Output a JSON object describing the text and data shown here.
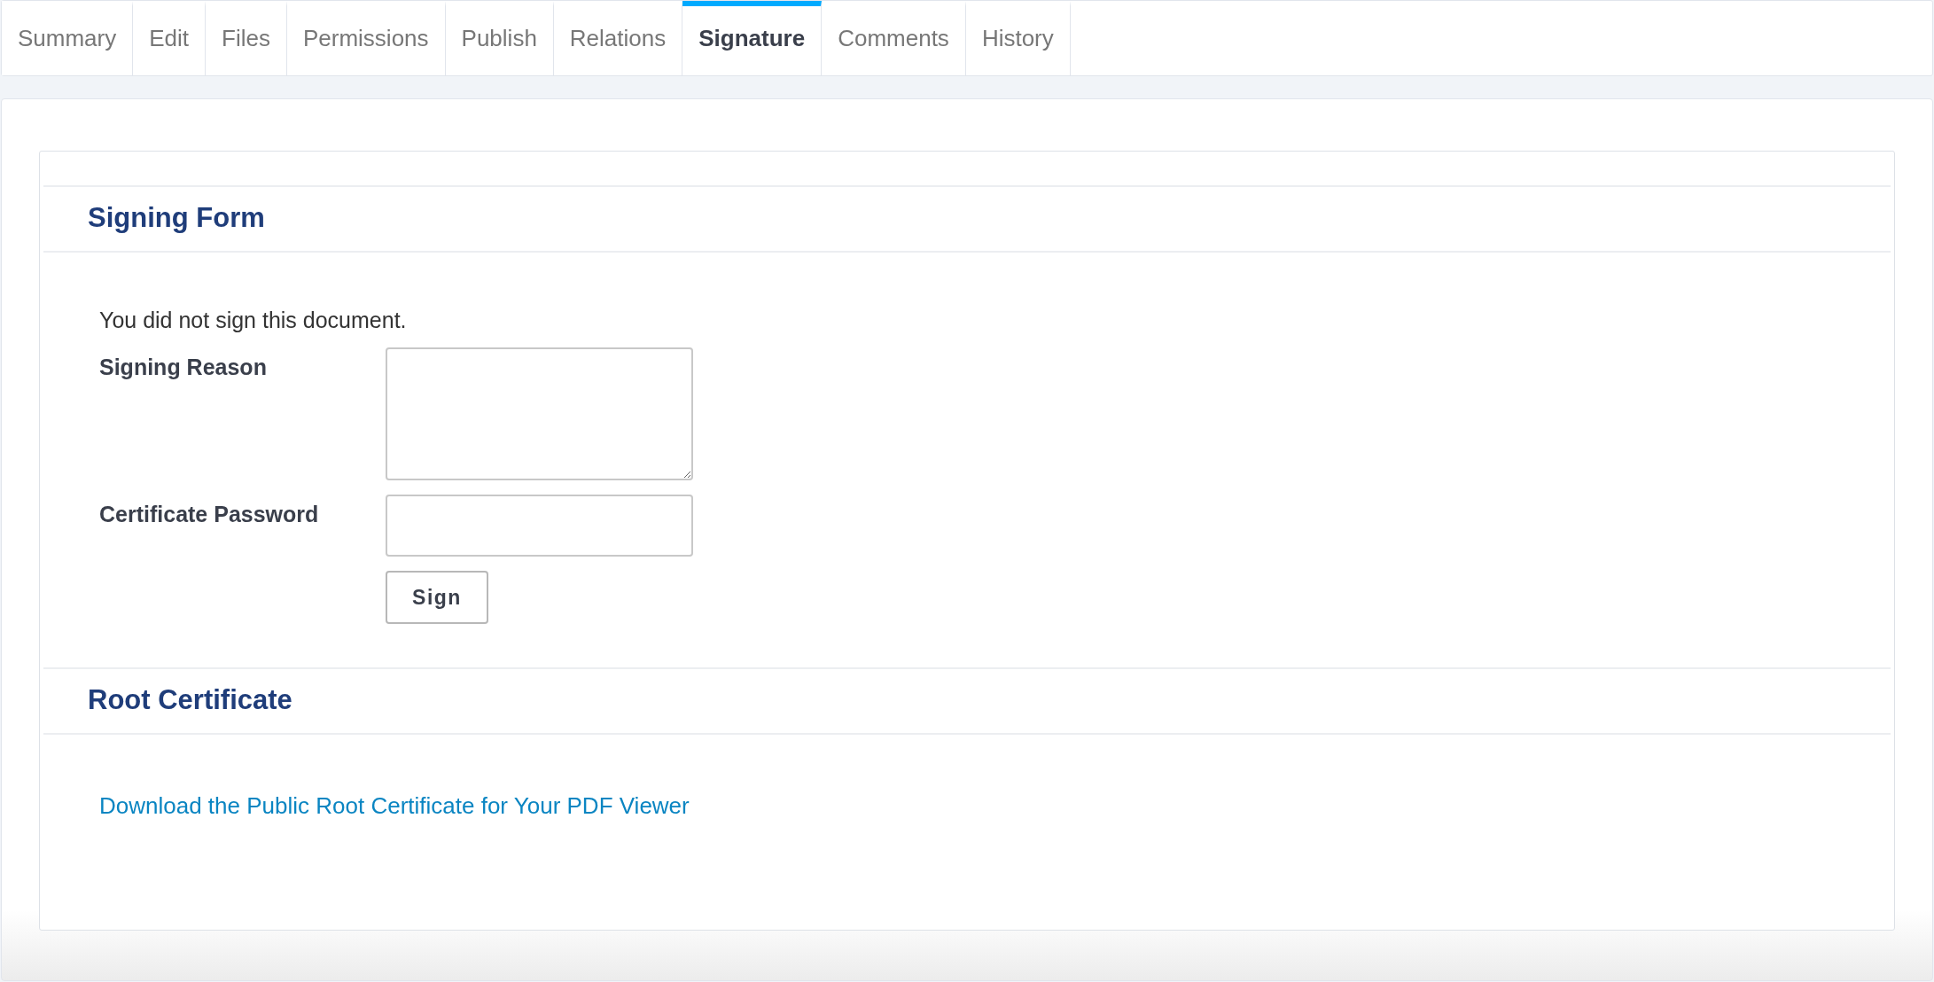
{
  "tabs": [
    {
      "label": "Summary",
      "selected": false
    },
    {
      "label": "Edit",
      "selected": false
    },
    {
      "label": "Files",
      "selected": false
    },
    {
      "label": "Permissions",
      "selected": false
    },
    {
      "label": "Publish",
      "selected": false
    },
    {
      "label": "Relations",
      "selected": false
    },
    {
      "label": "Signature",
      "selected": true
    },
    {
      "label": "Comments",
      "selected": false
    },
    {
      "label": "History",
      "selected": false
    }
  ],
  "signing_form": {
    "title": "Signing Form",
    "status": "You did not sign this document.",
    "fields": [
      {
        "kind": "textarea",
        "label": "Signing Reason"
      },
      {
        "kind": "password",
        "label": "Certificate Password"
      }
    ],
    "button": "Sign"
  },
  "root_certificate": {
    "title": "Root Certificate",
    "link": "Download the Public Root Certificate for Your PDF Viewer"
  }
}
